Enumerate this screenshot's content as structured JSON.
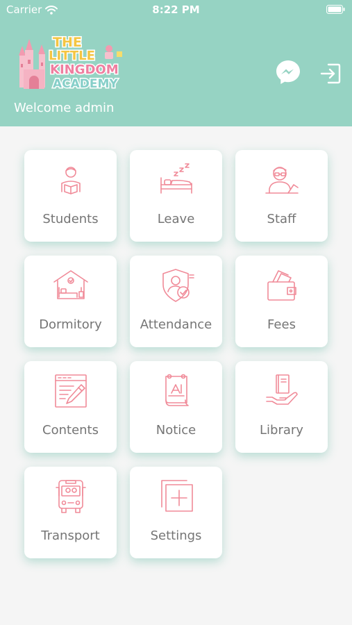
{
  "status_bar": {
    "carrier": "Carrier",
    "time": "8:22 PM"
  },
  "header": {
    "logo_text": [
      "THE",
      "LITTLE",
      "KINGDOM",
      "ACADEMY"
    ],
    "welcome": "Welcome admin",
    "colors": {
      "header_bg": "#96d3c3",
      "icon_accent": "#f08a98"
    }
  },
  "menu": [
    {
      "label": "Students",
      "icon": "student-reading-icon"
    },
    {
      "label": "Leave",
      "icon": "bed-sleep-icon"
    },
    {
      "label": "Staff",
      "icon": "teacher-icon"
    },
    {
      "label": "Dormitory",
      "icon": "dormitory-house-icon"
    },
    {
      "label": "Attendance",
      "icon": "shield-check-icon"
    },
    {
      "label": "Fees",
      "icon": "wallet-icon"
    },
    {
      "label": "Contents",
      "icon": "document-pencil-icon"
    },
    {
      "label": "Notice",
      "icon": "notice-board-icon"
    },
    {
      "label": "Library",
      "icon": "book-hand-icon"
    },
    {
      "label": "Transport",
      "icon": "bus-icon"
    },
    {
      "label": "Settings",
      "icon": "add-square-icon"
    }
  ]
}
